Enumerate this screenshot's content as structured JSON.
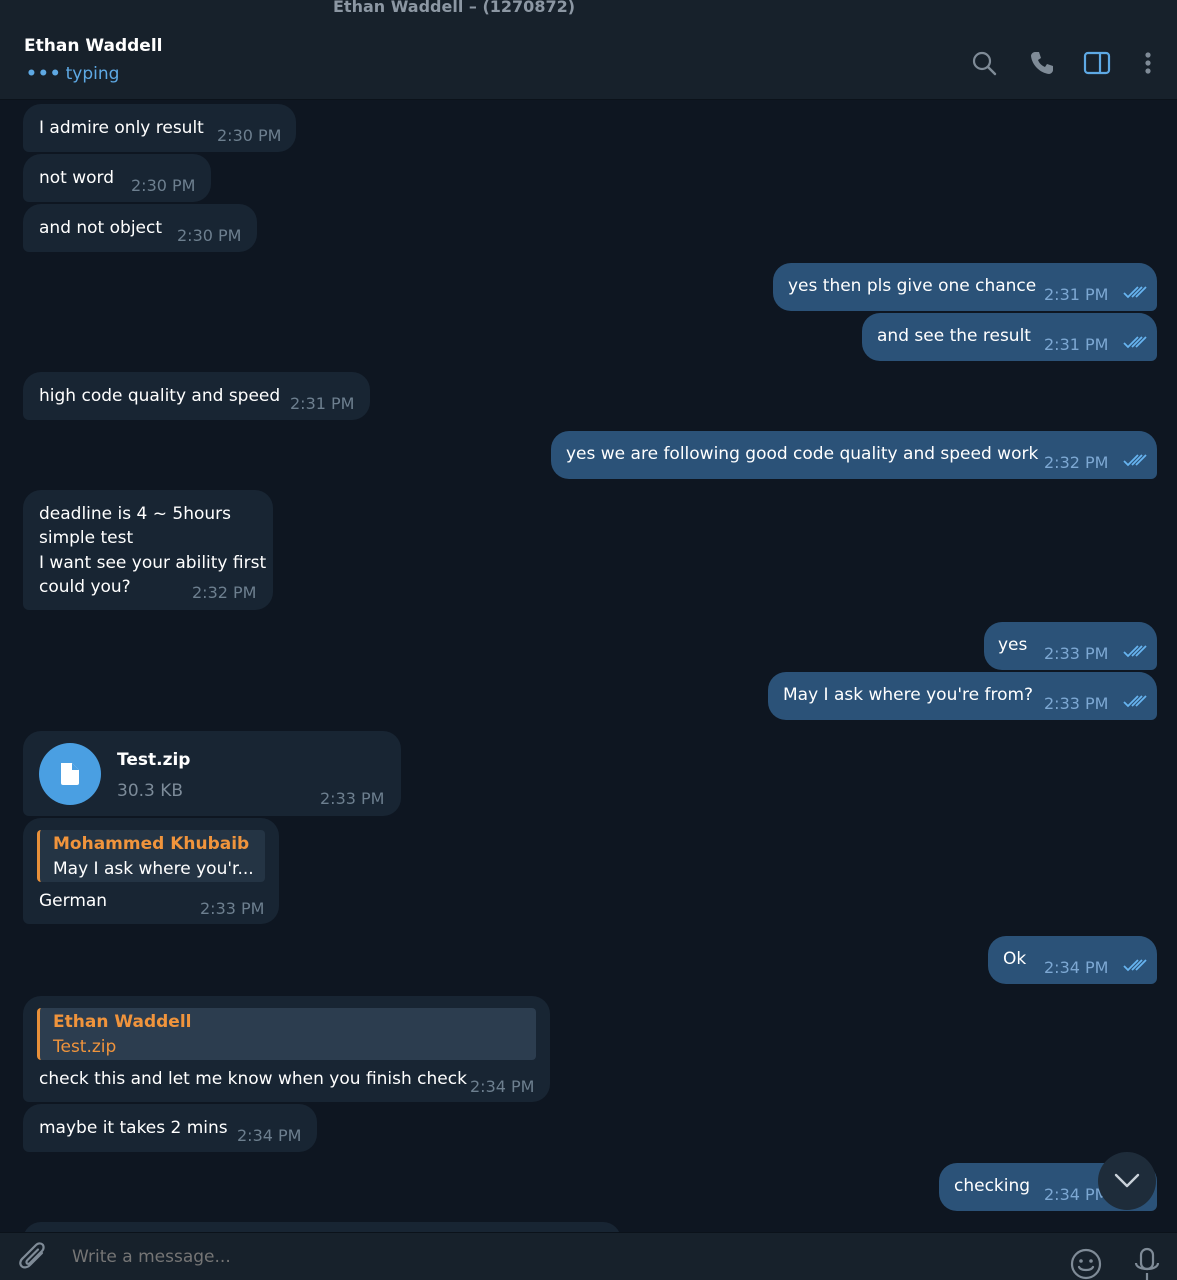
{
  "window": {
    "title": "Ethan Waddell – (1270872)"
  },
  "header": {
    "contact_name": "Ethan Waddell",
    "status_dots": "•••",
    "status": "typing",
    "icons": [
      "search-icon",
      "phone-icon",
      "sidebar-toggle-icon",
      "more-vertical-icon"
    ]
  },
  "messages": [
    {
      "dir": "in",
      "text": "I admire only result",
      "time": "2:30 PM"
    },
    {
      "dir": "in",
      "text": "not word",
      "time": "2:30 PM"
    },
    {
      "dir": "in",
      "text": "and not object",
      "time": "2:30 PM"
    },
    {
      "dir": "out",
      "text": "yes then pls give one chance",
      "time": "2:31 PM",
      "read": true
    },
    {
      "dir": "out",
      "text": "and see the result",
      "time": "2:31 PM",
      "read": true
    },
    {
      "dir": "in",
      "text": "high code quality and speed",
      "time": "2:31 PM"
    },
    {
      "dir": "out",
      "text": "yes we are following good code quality and speed work",
      "time": "2:32 PM",
      "read": true
    },
    {
      "dir": "in",
      "lines": [
        "deadline is 4 ~ 5hours",
        "simple test",
        "I want see your ability first",
        "could you?"
      ],
      "time": "2:32 PM"
    },
    {
      "dir": "out",
      "text": "yes",
      "time": "2:33 PM",
      "read": true
    },
    {
      "dir": "out",
      "text": "May I ask where you're from?",
      "time": "2:33 PM",
      "read": true
    },
    {
      "dir": "in",
      "file": {
        "name": "Test.zip",
        "size": "30.3 KB"
      },
      "time": "2:33 PM"
    },
    {
      "dir": "in",
      "reply": {
        "name": "Mohammed Khubaib",
        "text": "May I ask where you'r..."
      },
      "text": "German",
      "time": "2:33 PM"
    },
    {
      "dir": "out",
      "text": "Ok",
      "time": "2:34 PM",
      "read": true
    },
    {
      "dir": "in",
      "reply": {
        "name": "Ethan Waddell",
        "text": "Test.zip"
      },
      "text": "check this and let me know when you finish check",
      "time": "2:34 PM"
    },
    {
      "dir": "in",
      "text": "maybe it takes 2 mins",
      "time": "2:34 PM"
    },
    {
      "dir": "out",
      "text": "checking",
      "time": "2:34 PM",
      "read": true
    }
  ],
  "composer": {
    "placeholder": "Write a message...",
    "icons": [
      "attach-icon",
      "emoji-icon",
      "microphone-icon"
    ]
  },
  "colors": {
    "background": "#0e1621",
    "incoming_bubble": "#182533",
    "outgoing_bubble": "#2b5278",
    "accent": "#5ea9e4",
    "reply_name": "#f0943c"
  }
}
